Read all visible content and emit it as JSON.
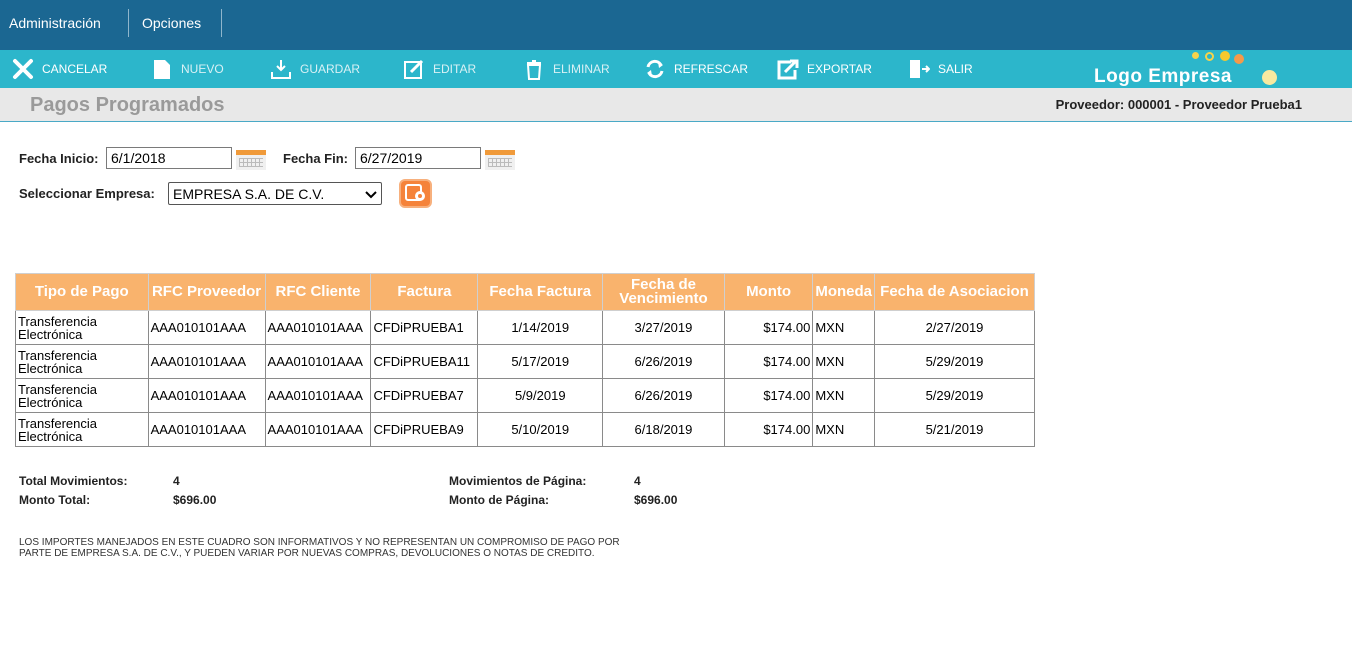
{
  "menu": {
    "items": [
      "Administración",
      "Opciones"
    ]
  },
  "toolbar": {
    "cancelar": "CANCELAR",
    "nuevo": "NUEVO",
    "guardar": "GUARDAR",
    "editar": "EDITAR",
    "eliminar": "ELIMINAR",
    "refrescar": "REFRESCAR",
    "exportar": "EXPORTAR",
    "salir": "SALIR"
  },
  "logo": {
    "text": "Logo Empresa"
  },
  "page": {
    "title": "Pagos Programados",
    "provider": "Proveedor: 000001 - Proveedor Prueba1"
  },
  "filters": {
    "fecha_inicio_label": "Fecha Inicio:",
    "fecha_inicio": "6/1/2018",
    "fecha_fin_label": "Fecha Fin:",
    "fecha_fin": "6/27/2019",
    "empresa_label": "Seleccionar Empresa:",
    "empresa": "EMPRESA S.A. DE C.V."
  },
  "table": {
    "headers": [
      "Tipo de Pago",
      "RFC Proveedor",
      "RFC Cliente",
      "Factura",
      "Fecha Factura",
      "Fecha de Vencimiento",
      "Monto",
      "Moneda",
      "Fecha de Asociacion"
    ],
    "rows": [
      {
        "tipo1": "Transferencia",
        "tipo2": "Electrónica",
        "rfc_proveedor": "AAA010101AAA",
        "rfc_cliente": "AAA010101AAA",
        "factura": "CFDiPRUEBA1",
        "fecha_factura": "1/14/2019",
        "fecha_vencimiento": "3/27/2019",
        "monto": "$174.00",
        "moneda": "MXN",
        "fecha_asociacion": "2/27/2019"
      },
      {
        "tipo1": "Transferencia",
        "tipo2": "Electrónica",
        "rfc_proveedor": "AAA010101AAA",
        "rfc_cliente": "AAA010101AAA",
        "factura": "CFDiPRUEBA11",
        "fecha_factura": "5/17/2019",
        "fecha_vencimiento": "6/26/2019",
        "monto": "$174.00",
        "moneda": "MXN",
        "fecha_asociacion": "5/29/2019"
      },
      {
        "tipo1": "Transferencia",
        "tipo2": "Electrónica",
        "rfc_proveedor": "AAA010101AAA",
        "rfc_cliente": "AAA010101AAA",
        "factura": "CFDiPRUEBA7",
        "fecha_factura": "5/9/2019",
        "fecha_vencimiento": "6/26/2019",
        "monto": "$174.00",
        "moneda": "MXN",
        "fecha_asociacion": "5/29/2019"
      },
      {
        "tipo1": "Transferencia",
        "tipo2": "Electrónica",
        "rfc_proveedor": "AAA010101AAA",
        "rfc_cliente": "AAA010101AAA",
        "factura": "CFDiPRUEBA9",
        "fecha_factura": "5/10/2019",
        "fecha_vencimiento": "6/18/2019",
        "monto": "$174.00",
        "moneda": "MXN",
        "fecha_asociacion": "5/21/2019"
      }
    ]
  },
  "totals": {
    "total_movimientos_label": "Total Movimientos:",
    "total_movimientos": "4",
    "monto_total_label": "Monto Total:",
    "monto_total": "$696.00",
    "movimientos_pagina_label": "Movimientos de Página:",
    "movimientos_pagina": "4",
    "monto_pagina_label": "Monto de Página:",
    "monto_pagina": "$696.00"
  },
  "disclaimer": {
    "line1": "LOS IMPORTES MANEJADOS EN ESTE CUADRO SON INFORMATIVOS Y NO REPRESENTAN UN COMPROMISO DE PAGO POR",
    "line2": "PARTE DE EMPRESA S.A. DE C.V., Y PUEDEN VARIAR POR NUEVAS COMPRAS, DEVOLUCIONES O NOTAS DE CREDITO."
  },
  "colors": {
    "topbar": "#1b6792",
    "toolbar": "#2cb6cb",
    "table_header": "#f9b36d",
    "accent_orange": "#f5833a"
  }
}
